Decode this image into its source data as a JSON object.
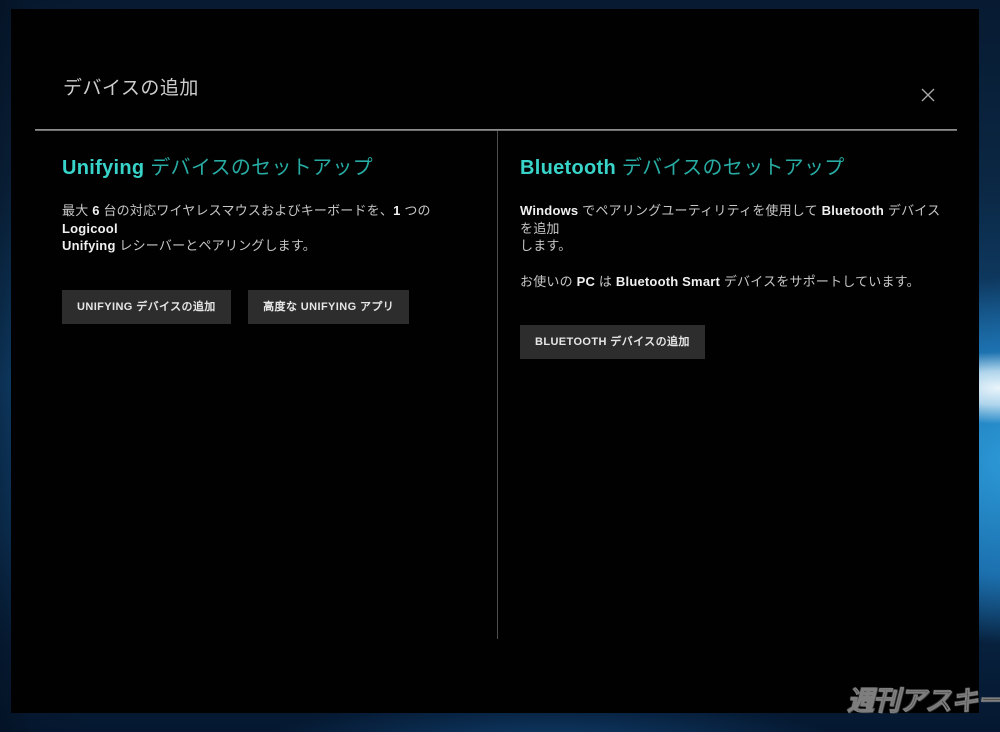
{
  "dialog": {
    "title": "デバイスの追加"
  },
  "icons": {
    "close": "✕"
  },
  "unifying": {
    "heading_brand": "Unifying",
    "heading_rest": " デバイスのセットアップ",
    "desc": {
      "p1": "最大 ",
      "b1": "6",
      "p2": " 台の対応ワイヤレスマウスおよびキーボードを、",
      "b2": "1",
      "p3": " つの ",
      "b3": "Logicool",
      "b4": "Unifying",
      "p4": " レシーバーとペアリングします。"
    },
    "buttons": {
      "add": "UNIFYING デバイスの追加",
      "advanced": "高度な UNIFYING アプリ"
    }
  },
  "bluetooth": {
    "heading_brand": "Bluetooth",
    "heading_rest": " デバイスのセットアップ",
    "desc1": {
      "b1": "Windows",
      "p1": " でペアリングユーティリティを使用して ",
      "b2": "Bluetooth",
      "p2": " デバイスを追加",
      "p3": "します。"
    },
    "desc2": {
      "p1": "お使いの ",
      "b1": "PC",
      "p2": " は ",
      "b2": "Bluetooth Smart",
      "p3": " デバイスをサポートしています。"
    },
    "button": "BLUETOOTH デバイスの追加"
  },
  "watermark": "週刊アスキー",
  "colors": {
    "accent_teal": "#38d4ca",
    "accent_teal_dim": "#27aba2",
    "dialog_bg": "#010101",
    "button_bg": "#2d2d2d",
    "desktop_blue": "#11497a"
  }
}
